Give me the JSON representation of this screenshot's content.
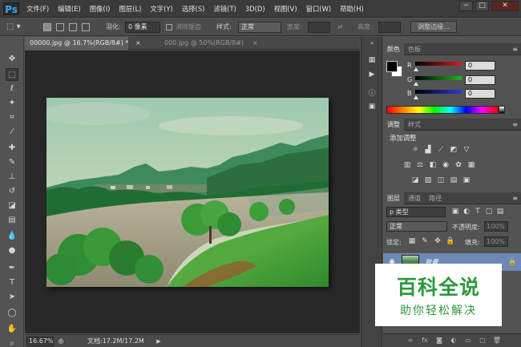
{
  "app": {
    "logo": "Ps",
    "menu": [
      "文件(F)",
      "编辑(E)",
      "图像(I)",
      "图层(L)",
      "文字(Y)",
      "选择(S)",
      "滤镜(T)",
      "3D(D)",
      "视图(V)",
      "窗口(W)",
      "帮助(H)"
    ],
    "window_controls": {
      "minimize": "−",
      "maximize": "□",
      "close": "✕"
    }
  },
  "options": {
    "feather_label": "羽化:",
    "feather_value": "0 像素",
    "antialias_label": "消除锯齿",
    "style_label": "样式:",
    "style_value": "正常",
    "width_label": "宽度:",
    "height_label": "高度:",
    "refine_edge": "调整边缘..."
  },
  "documents": {
    "active_tab": "00000.jpg @ 16.7%(RGB/8#) *",
    "inactive_tab": "000.jpg @ 50%(RGB/8#)",
    "close_glyph": "×"
  },
  "status": {
    "zoom": "16.67%",
    "doc_info": "文档:17.2M/17.2M",
    "arrow": "▶"
  },
  "color_panel": {
    "tabs": [
      "颜色",
      "色板"
    ],
    "r_label": "R",
    "r_value": "0",
    "g_label": "G",
    "g_value": "0",
    "b_label": "B",
    "b_value": "0",
    "r_color": "#d42020",
    "g_color": "#23b321",
    "b_color": "#2d3ad6"
  },
  "adjustments_panel": {
    "tabs": [
      "调整",
      "样式"
    ],
    "title": "添加调整"
  },
  "layers_panel": {
    "tabs": [
      "图层",
      "通道",
      "路径"
    ],
    "filter_label": "p 类型",
    "blend_mode": "正常",
    "opacity_label": "不透明度:",
    "opacity_value": "100%",
    "lock_label": "锁定:",
    "fill_label": "填充:",
    "fill_value": "100%",
    "layer_name": "背景"
  },
  "watermark": {
    "title": "百科全说",
    "subtitle": "助你轻松解决"
  }
}
